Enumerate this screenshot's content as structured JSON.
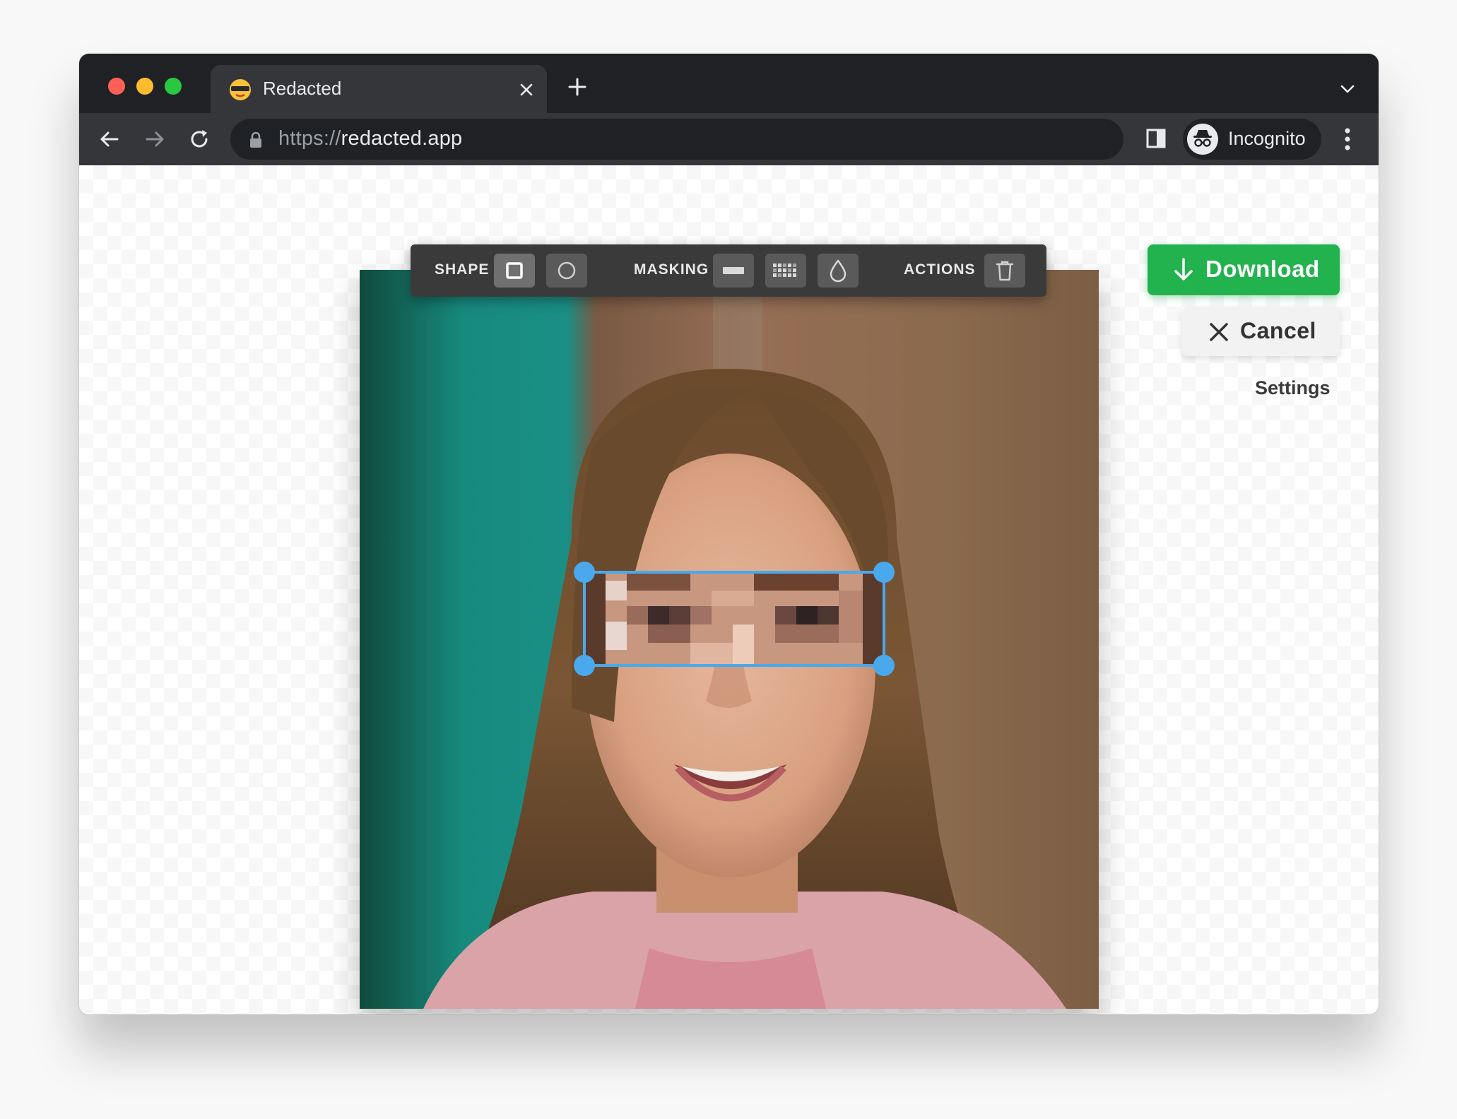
{
  "browser": {
    "tab_title": "Redacted",
    "url_scheme": "https://",
    "url_host": "redacted.app",
    "profile_label": "Incognito",
    "icons": [
      "close-icon",
      "plus-icon",
      "chevron-down-icon",
      "back-icon",
      "forward-icon",
      "reload-icon",
      "lock-icon",
      "star-icon",
      "side-panel-icon",
      "incognito-icon",
      "more-vert-icon"
    ]
  },
  "editor": {
    "shape_label": "SHAPE",
    "masking_label": "MASKING",
    "actions_label": "ACTIONS",
    "shape_options": [
      "square-icon",
      "circle-icon"
    ],
    "shape_selected": "square-icon",
    "masking_options": [
      "solid-bar-icon",
      "pixelate-icon",
      "blur-drop-icon"
    ],
    "action_options": [
      "trash-icon"
    ]
  },
  "sidebar": {
    "download_label": "Download",
    "cancel_label": "Cancel",
    "settings_label": "Settings"
  },
  "colors": {
    "download_bg": "#22b34f",
    "selection": "#4aa8ec",
    "chrome_dark": "#202124",
    "chrome_toolbar": "#35363a"
  }
}
